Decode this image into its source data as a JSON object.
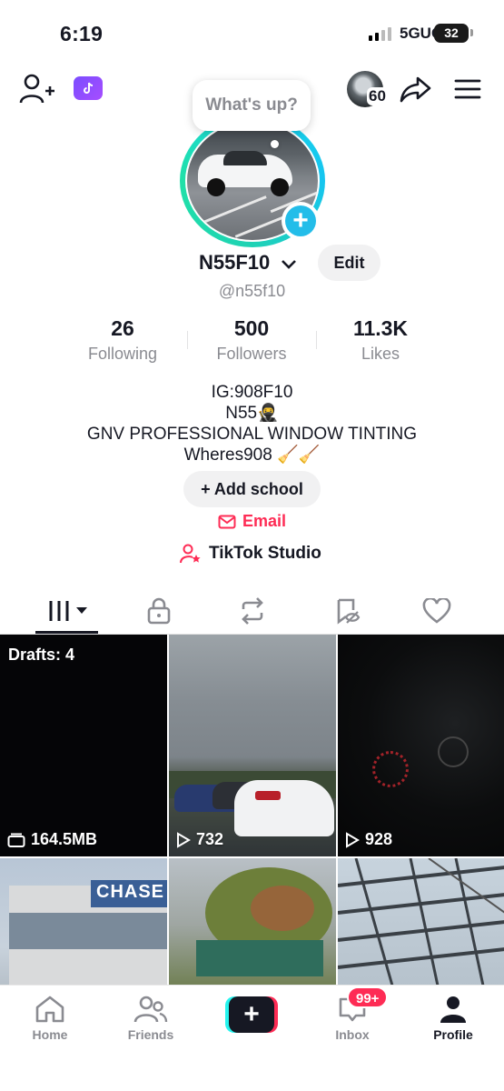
{
  "status_bar": {
    "time": "6:19",
    "network": "5GUC",
    "battery": "32"
  },
  "top_bar": {
    "story_avatar_count": "60"
  },
  "bubble": {
    "text": "What's up?"
  },
  "profile": {
    "display_name": "N55F10",
    "username": "@n55f10",
    "edit_label": "Edit",
    "stats": [
      {
        "value": "26",
        "label": "Following"
      },
      {
        "value": "500",
        "label": "Followers"
      },
      {
        "value": "11.3K",
        "label": "Likes"
      }
    ],
    "bio_lines": [
      "IG:908F10",
      "N55🥷",
      "GNV PROFESSIONAL WINDOW TINTING",
      "Wheres908 🧹🧹"
    ],
    "add_school_label": "Add school",
    "email_label": "Email",
    "studio_label": "TikTok Studio"
  },
  "tabs": [
    "videos",
    "private",
    "reposts",
    "favorites-hidden",
    "liked"
  ],
  "grid": {
    "drafts_label": "Drafts: 4",
    "drafts_size": "164.5MB",
    "views": [
      "732",
      "928"
    ],
    "chase_sign": "CHASE"
  },
  "nav": {
    "home": "Home",
    "friends": "Friends",
    "inbox": "Inbox",
    "inbox_badge": "99+",
    "profile": "Profile"
  },
  "colors": {
    "brand_red": "#fe2c55",
    "brand_cyan": "#25f4ee",
    "text": "#161823",
    "muted": "#8a8b91"
  }
}
